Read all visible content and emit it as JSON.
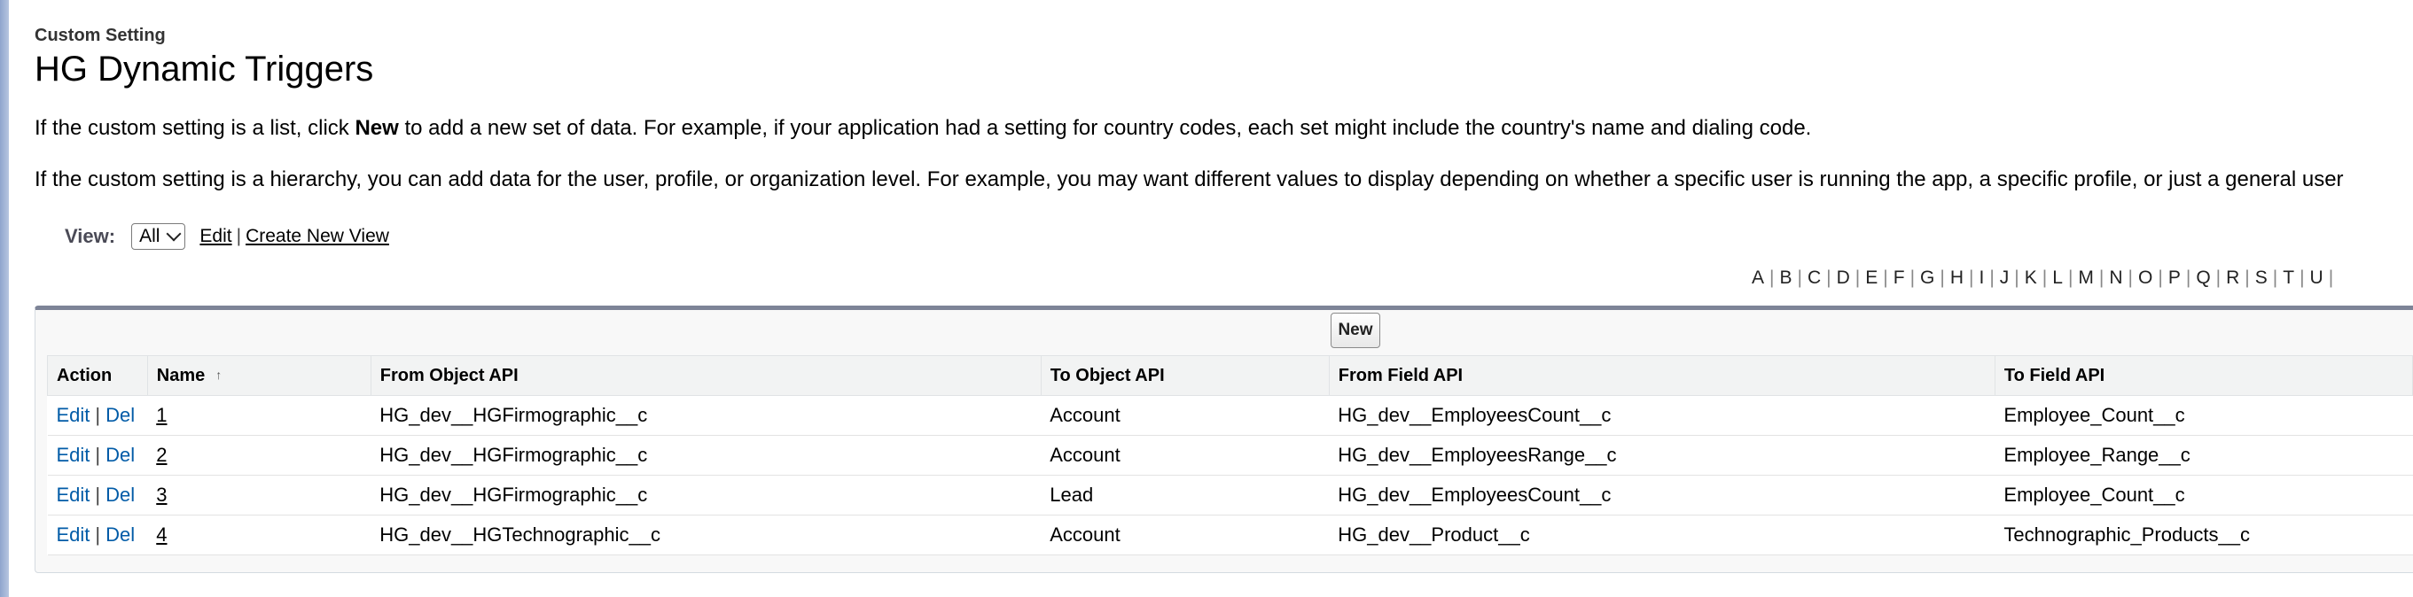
{
  "header": {
    "breadcrumb": "Custom Setting",
    "title": "HG Dynamic Triggers"
  },
  "description": {
    "line1_pre": "If the custom setting is a list, click ",
    "line1_bold": "New",
    "line1_post": " to add a new set of data. For example, if your application had a setting for country codes, each set might include the country's name and dialing code.",
    "line2": "If the custom setting is a hierarchy, you can add data for the user, profile, or organization level. For example, you may want different values to display depending on whether a specific user is running the app, a specific profile, or just a general user"
  },
  "view": {
    "label": "View:",
    "selected": "All",
    "edit_link": "Edit",
    "separator": "|",
    "create_link": "Create New View"
  },
  "alphabet": [
    "A",
    "B",
    "C",
    "D",
    "E",
    "F",
    "G",
    "H",
    "I",
    "J",
    "K",
    "L",
    "M",
    "N",
    "O",
    "P",
    "Q",
    "R",
    "S",
    "T",
    "U"
  ],
  "alphabet_separator": "|",
  "new_button": "New",
  "table": {
    "columns": [
      "Action",
      "Name",
      "From Object API",
      "To Object API",
      "From Field API",
      "To Field API"
    ],
    "sort_indicator": "↑",
    "action_edit": "Edit",
    "action_sep": "|",
    "action_del": "Del",
    "rows": [
      {
        "name": "1",
        "from_object": "HG_dev__HGFirmographic__c",
        "to_object": "Account",
        "from_field": "HG_dev__EmployeesCount__c",
        "to_field": "Employee_Count__c"
      },
      {
        "name": "2",
        "from_object": "HG_dev__HGFirmographic__c",
        "to_object": "Account",
        "from_field": "HG_dev__EmployeesRange__c",
        "to_field": "Employee_Range__c"
      },
      {
        "name": "3",
        "from_object": "HG_dev__HGFirmographic__c",
        "to_object": "Lead",
        "from_field": "HG_dev__EmployeesCount__c",
        "to_field": "Employee_Count__c"
      },
      {
        "name": "4",
        "from_object": "HG_dev__HGTechnographic__c",
        "to_object": "Account",
        "from_field": "HG_dev__Product__c",
        "to_field": "Technographic_Products__c"
      }
    ]
  }
}
